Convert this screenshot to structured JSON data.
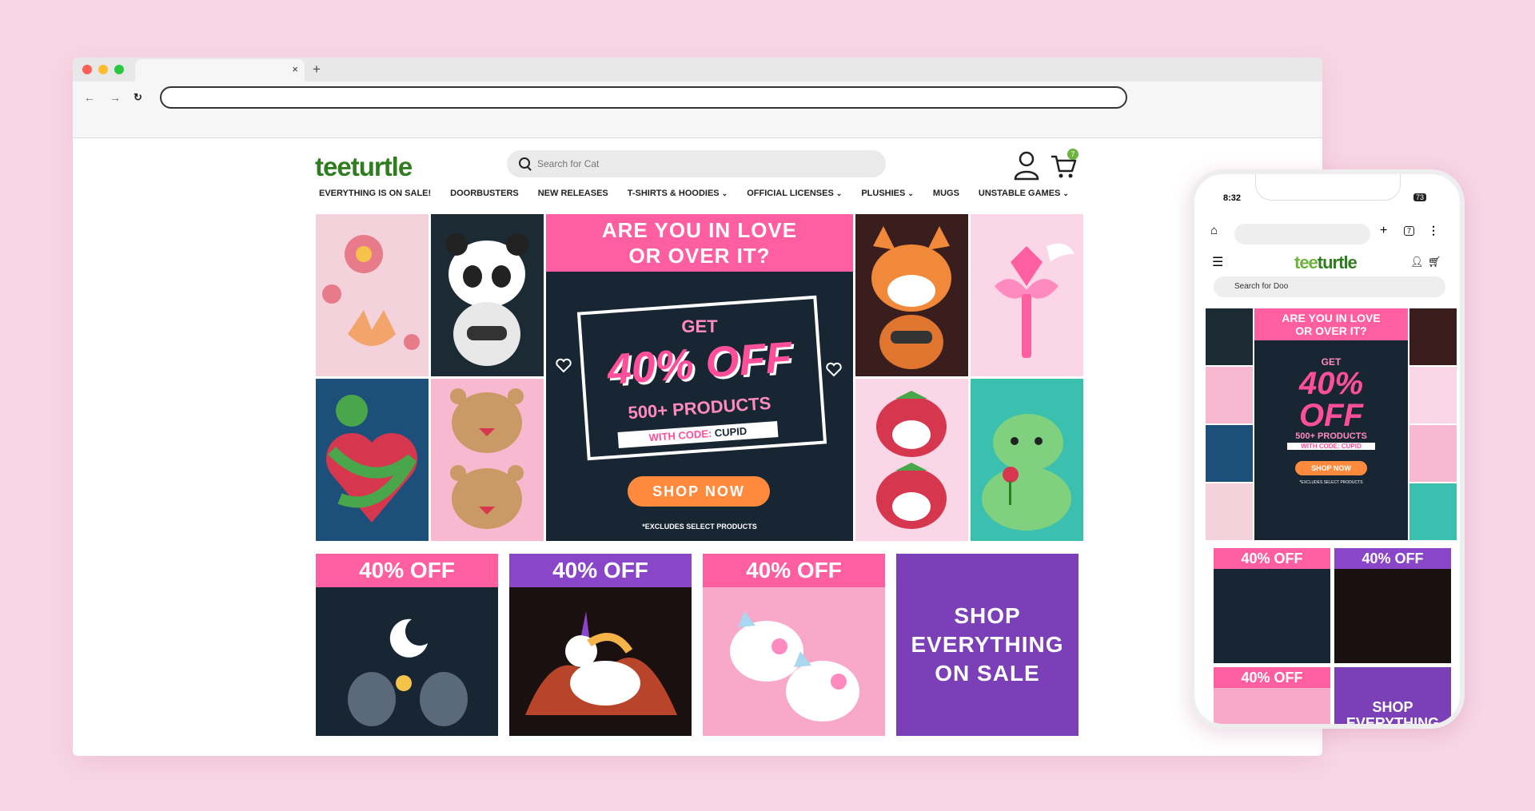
{
  "browser": {
    "new_tab_symbol": "+",
    "close_symbol": "×"
  },
  "site": {
    "logo": {
      "part1": "tee",
      "part2": "turtle"
    },
    "search_placeholder": "Search for Cat",
    "cart_count": "7",
    "nav": [
      {
        "label": "EVERYTHING IS ON SALE!",
        "caret": false
      },
      {
        "label": "DOORBUSTERS",
        "caret": false
      },
      {
        "label": "NEW RELEASES",
        "caret": false
      },
      {
        "label": "T-SHIRTS & HOODIES",
        "caret": true
      },
      {
        "label": "OFFICIAL LICENSES",
        "caret": true
      },
      {
        "label": "PLUSHIES",
        "caret": true
      },
      {
        "label": "MUGS",
        "caret": false
      },
      {
        "label": "UNSTABLE GAMES",
        "caret": true
      }
    ],
    "hero": {
      "headline_line1": "ARE YOU IN LOVE",
      "headline_line2": "OR OVER IT?",
      "get": "GET",
      "discount": "40% OFF",
      "products": "500+ PRODUCTS",
      "code_prefix": "WITH CODE:",
      "code": "CUPID",
      "button": "SHOP NOW",
      "disclaimer": "*EXCLUDES SELECT PRODUCTS"
    },
    "promos": [
      {
        "label": "40% OFF",
        "color": "#ff5fa0"
      },
      {
        "label": "40% OFF",
        "color": "#8a46c8"
      },
      {
        "label": "40% OFF",
        "color": "#ff5fa0"
      }
    ],
    "shop_all": {
      "line1": "SHOP",
      "line2": "EVERYTHING",
      "line3": "ON SALE"
    }
  },
  "phone": {
    "time": "8:32",
    "battery": "73",
    "tab_count": "7",
    "logo": {
      "part1": "tee",
      "part2": "turtle"
    },
    "search_placeholder": "Search for Doo",
    "hero": {
      "headline_line1": "ARE YOU IN LOVE",
      "headline_line2": "OR OVER IT?",
      "get": "GET",
      "discount_line1": "40%",
      "discount_line2": "OFF",
      "products": "500+ PRODUCTS",
      "code": "WITH CODE: CUPID",
      "button": "SHOP NOW",
      "disclaimer": "*EXCLUDES SELECT PRODUCTS"
    },
    "promos": [
      "40% OFF",
      "40% OFF",
      "40% OFF"
    ],
    "shop_all": {
      "line1": "SHOP",
      "line2": "EVERYTHING"
    }
  },
  "colors": {
    "brand_green": "#6db33f",
    "pink": "#ff5fa0",
    "purple": "#7b3fb8",
    "orange": "#ff8a3d",
    "navy": "#182532"
  }
}
